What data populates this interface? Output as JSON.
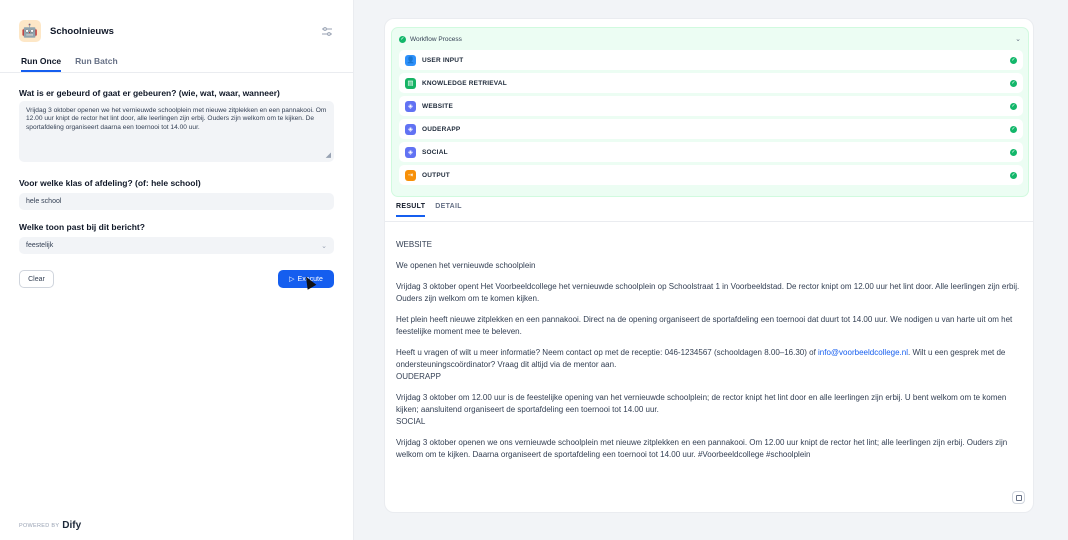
{
  "app": {
    "title": "Schoolnieuws",
    "icon": "robot-icon",
    "powered_by": "POWERED BY",
    "brand": "Dify"
  },
  "tabs": [
    {
      "label": "Run Once",
      "active": true
    },
    {
      "label": "Run Batch",
      "active": false
    }
  ],
  "form": {
    "q1_label": "Wat is er gebeurd of gaat er gebeuren? (wie, wat, waar, wanneer)",
    "q1_value": "Vrijdag 3 oktober openen we het vernieuwde schoolplein met nieuwe zitplekken en een pannakooi. Om 12.00 uur knipt de rector het lint door, alle leerlingen zijn erbij. Ouders zijn welkom om te kijken. De sportafdeling organiseert daarna een toernooi tot 14.00 uur.",
    "q2_label": "Voor welke klas of afdeling? (of: hele school)",
    "q2_value": "hele school",
    "q3_label": "Welke toon past bij dit bericht?",
    "q3_value": "feestelijk",
    "clear_label": "Clear",
    "execute_label": "Execute"
  },
  "workflow": {
    "title": "Workflow Process",
    "status_color": "#12b76a",
    "steps": [
      {
        "label": "USER INPUT",
        "icon": "user-icon",
        "color": "#2e90fa"
      },
      {
        "label": "KNOWLEDGE RETRIEVAL",
        "icon": "database-icon",
        "color": "#16b364"
      },
      {
        "label": "WEBSITE",
        "icon": "llm-icon",
        "color": "#6172f3"
      },
      {
        "label": "OUDERAPP",
        "icon": "llm-icon",
        "color": "#6172f3"
      },
      {
        "label": "SOCIAL",
        "icon": "llm-icon",
        "color": "#6172f3"
      },
      {
        "label": "OUTPUT",
        "icon": "output-icon",
        "color": "#f79009"
      }
    ]
  },
  "result_tabs": [
    {
      "label": "RESULT",
      "active": true
    },
    {
      "label": "DETAIL",
      "active": false
    }
  ],
  "result": {
    "h_website": "WEBSITE",
    "website_title": "We openen het vernieuwde schoolplein",
    "website_p1": "Vrijdag 3 oktober opent Het Voorbeeldcollege het vernieuwde schoolplein op Schoolstraat 1 in Voorbeeldstad. De rector knipt om 12.00 uur het lint door. Alle leerlingen zijn erbij. Ouders zijn welkom om te komen kijken.",
    "website_p2": "Het plein heeft nieuwe zitplekken en een pannakooi. Direct na de opening organiseert de sportafdeling een toernooi dat duurt tot 14.00 uur. We nodigen u van harte uit om het feestelijke moment mee te beleven.",
    "website_p3_a": "Heeft u vragen of wilt u meer informatie? Neem contact op met de receptie: 046-1234567 (schooldagen 8.00–16.30) of ",
    "website_email": "info@voorbeeldcollege.nl",
    "website_p3_b": ". Wilt u een gesprek met de ondersteuningscoördinator? Vraag dit altijd via de mentor aan.",
    "h_ouderapp": "OUDERAPP",
    "ouderapp_p": "Vrijdag 3 oktober om 12.00 uur is de feestelijke opening van het vernieuwde schoolplein; de rector knipt het lint door en alle leerlingen zijn erbij. U bent welkom om te komen kijken; aansluitend organiseert de sportafdeling een toernooi tot 14.00 uur.",
    "h_social": "SOCIAL",
    "social_p": "Vrijdag 3 oktober openen we ons vernieuwde schoolplein met nieuwe zitplekken en een pannakooi. Om 12.00 uur knipt de rector het lint; alle leerlingen zijn erbij. Ouders zijn welkom om te kijken. Daarna organiseert de sportafdeling een toernooi tot 14.00 uur. #Voorbeeldcollege #schoolplein"
  }
}
